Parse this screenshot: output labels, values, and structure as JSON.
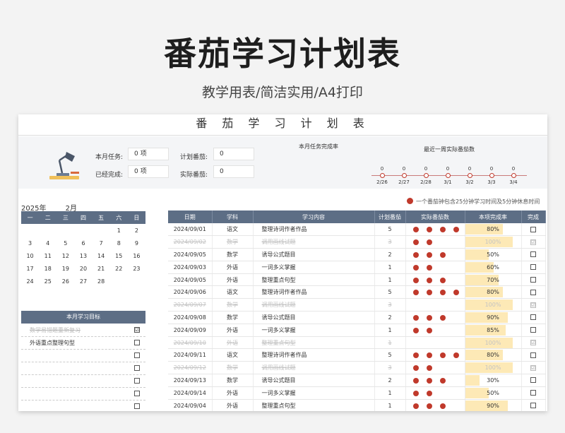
{
  "hero": {
    "title": "番茄学习计划表",
    "subtitle": "教学用表/简洁实用/A4打印"
  },
  "sheet_title": "番 茄 学 习 计 划 表",
  "summary": {
    "month_tasks_label": "本月任务:",
    "month_tasks_value": "0 项",
    "completed_label": "已经完成:",
    "completed_value": "0 项",
    "planned_label": "计划番茄:",
    "planned_value": "0",
    "actual_label": "实际番茄:",
    "actual_value": "0",
    "rate_title": "本月任务完成率",
    "week_title": "最近一周实际番茄数",
    "week": [
      {
        "date": "2/26",
        "count": "0"
      },
      {
        "date": "2/27",
        "count": "0"
      },
      {
        "date": "2/28",
        "count": "0"
      },
      {
        "date": "3/1",
        "count": "0"
      },
      {
        "date": "3/2",
        "count": "0"
      },
      {
        "date": "3/3",
        "count": "0"
      },
      {
        "date": "3/4",
        "count": "0"
      }
    ]
  },
  "calendar": {
    "year": "2025年",
    "month": "2月",
    "weekdays": [
      "一",
      "二",
      "三",
      "四",
      "五",
      "六",
      "日"
    ],
    "weeks": [
      [
        "",
        "",
        "",
        "",
        "",
        "1",
        "2"
      ],
      [
        "3",
        "4",
        "5",
        "6",
        "7",
        "8",
        "9"
      ],
      [
        "10",
        "11",
        "12",
        "13",
        "14",
        "15",
        "16"
      ],
      [
        "17",
        "18",
        "19",
        "20",
        "21",
        "22",
        "23"
      ],
      [
        "24",
        "25",
        "26",
        "27",
        "28",
        "",
        ""
      ]
    ]
  },
  "goals": {
    "title": "本月学习目标",
    "items": [
      {
        "text": "数学易错题重新复习",
        "done": true,
        "mark": "☑"
      },
      {
        "text": "外语重点整理句型",
        "done": false,
        "mark": ""
      },
      {
        "text": "",
        "done": false,
        "mark": ""
      },
      {
        "text": "",
        "done": false,
        "mark": ""
      },
      {
        "text": "",
        "done": false,
        "mark": ""
      },
      {
        "text": "",
        "done": false,
        "mark": ""
      },
      {
        "text": "",
        "done": false,
        "mark": ""
      }
    ]
  },
  "legend": "一个番茄钟包含25分钟学习时间及5分钟休息时间",
  "table": {
    "headers": [
      "日期",
      "学科",
      "学习内容",
      "计划番茄",
      "实际番茄数",
      "本项完成率",
      "完成"
    ],
    "rows": [
      {
        "date": "2024/09/01",
        "subject": "语文",
        "content": "整理诗词作者作品",
        "plan": "5",
        "tomatoes": 4,
        "rate": "80%",
        "rate_value": 80,
        "done": false,
        "mark": ""
      },
      {
        "date": "2024/09/02",
        "subject": "数学",
        "content": "调用画线试题",
        "plan": "3",
        "tomatoes": 2,
        "rate": "100%",
        "rate_value": 100,
        "done": true,
        "mark": "☑"
      },
      {
        "date": "2024/09/05",
        "subject": "数学",
        "content": "诱导公式题目",
        "plan": "2",
        "tomatoes": 3,
        "rate": "50%",
        "rate_value": 50,
        "done": false,
        "mark": ""
      },
      {
        "date": "2024/09/03",
        "subject": "外语",
        "content": "一词多义掌握",
        "plan": "1",
        "tomatoes": 2,
        "rate": "60%",
        "rate_value": 60,
        "done": false,
        "mark": ""
      },
      {
        "date": "2024/09/05",
        "subject": "外语",
        "content": "整理重点句型",
        "plan": "1",
        "tomatoes": 3,
        "rate": "70%",
        "rate_value": 70,
        "done": false,
        "mark": ""
      },
      {
        "date": "2024/09/06",
        "subject": "语文",
        "content": "整理诗词作者作品",
        "plan": "5",
        "tomatoes": 4,
        "rate": "80%",
        "rate_value": 80,
        "done": false,
        "mark": ""
      },
      {
        "date": "2024/09/07",
        "subject": "数学",
        "content": "调用画线试题",
        "plan": "3",
        "tomatoes": 0,
        "rate": "100%",
        "rate_value": 100,
        "done": true,
        "mark": "☑"
      },
      {
        "date": "2024/09/08",
        "subject": "数学",
        "content": "诱导公式题目",
        "plan": "2",
        "tomatoes": 3,
        "rate": "90%",
        "rate_value": 90,
        "done": false,
        "mark": ""
      },
      {
        "date": "2024/09/09",
        "subject": "外语",
        "content": "一词多义掌握",
        "plan": "1",
        "tomatoes": 2,
        "rate": "85%",
        "rate_value": 85,
        "done": false,
        "mark": ""
      },
      {
        "date": "2024/09/10",
        "subject": "外语",
        "content": "整理重点句型",
        "plan": "1",
        "tomatoes": 0,
        "rate": "100%",
        "rate_value": 100,
        "done": true,
        "mark": "☑"
      },
      {
        "date": "2024/09/11",
        "subject": "语文",
        "content": "整理诗词作者作品",
        "plan": "5",
        "tomatoes": 4,
        "rate": "80%",
        "rate_value": 80,
        "done": false,
        "mark": ""
      },
      {
        "date": "2024/09/12",
        "subject": "数学",
        "content": "调用画线试题",
        "plan": "3",
        "tomatoes": 2,
        "rate": "100%",
        "rate_value": 100,
        "done": true,
        "mark": "☑"
      },
      {
        "date": "2024/09/13",
        "subject": "数学",
        "content": "诱导公式题目",
        "plan": "2",
        "tomatoes": 3,
        "rate": "30%",
        "rate_value": 30,
        "done": false,
        "mark": ""
      },
      {
        "date": "2024/09/14",
        "subject": "外语",
        "content": "一词多义掌握",
        "plan": "1",
        "tomatoes": 2,
        "rate": "50%",
        "rate_value": 50,
        "done": false,
        "mark": ""
      },
      {
        "date": "2024/09/04",
        "subject": "外语",
        "content": "整理重点句型",
        "plan": "1",
        "tomatoes": 3,
        "rate": "90%",
        "rate_value": 90,
        "done": false,
        "mark": ""
      }
    ]
  },
  "colors": {
    "header": "#5d6e85",
    "tomato": "#c0392b",
    "bar": "#fde9b6"
  }
}
